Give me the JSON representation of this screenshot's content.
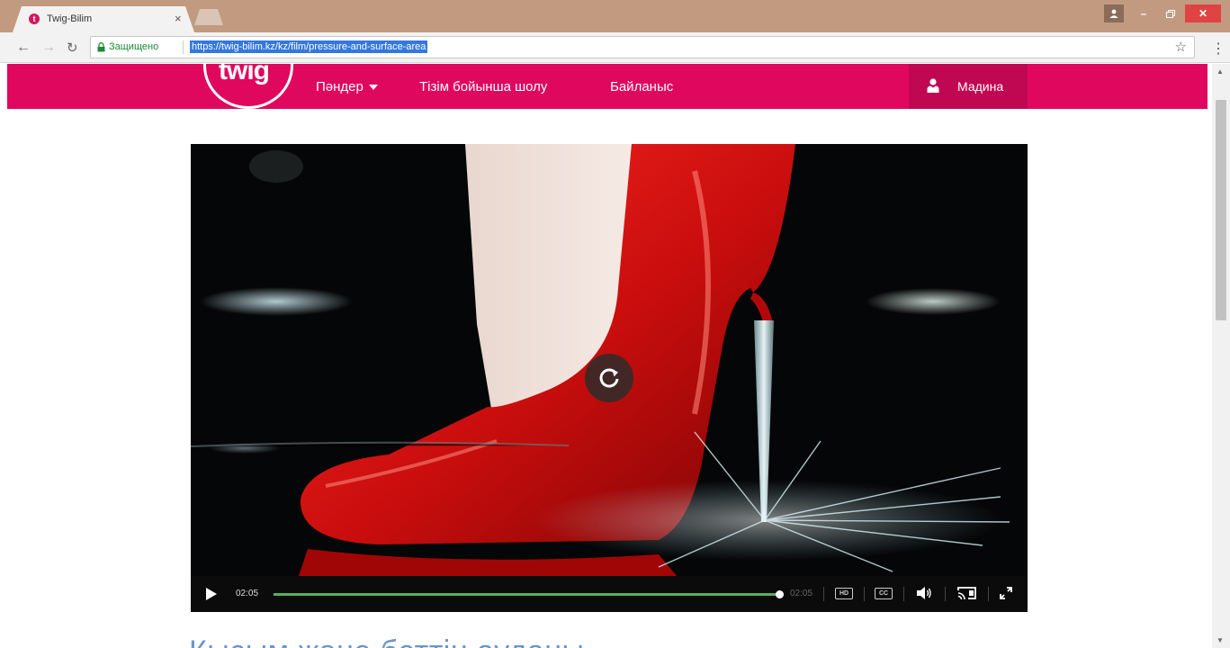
{
  "browser": {
    "tab_title": "Twig-Bilim",
    "tab_favicon": "twig-favicon",
    "security_label": "Защищено",
    "url": "https://twig-bilim.kz/kz/film/pressure-and-surface-area"
  },
  "site_nav": {
    "logo_text": "twig",
    "links": [
      "Пәндер",
      "Тізім бойынша шолу",
      "Байланыс"
    ],
    "user_name": "Мадина"
  },
  "video": {
    "current_time": "02:05",
    "total_time": "02:05",
    "progress": 1.0,
    "hd_label": "HD",
    "cc_label": "CC",
    "progress_color": "#56b15b"
  },
  "page": {
    "heading": "Қысым және беттің ауданы"
  },
  "colors": {
    "brand": "#e0075f",
    "user_box": "#c00752",
    "heading": "#6a95c8"
  }
}
